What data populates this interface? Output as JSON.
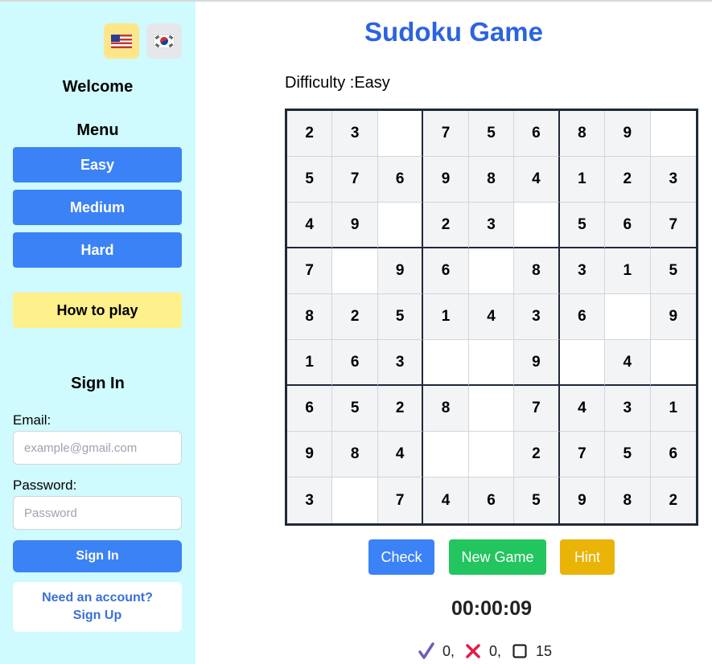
{
  "sidebar": {
    "languages": [
      {
        "code": "en",
        "icon": "us-flag-icon"
      },
      {
        "code": "ko",
        "icon": "kr-flag-icon"
      }
    ],
    "welcome": "Welcome",
    "menu_title": "Menu",
    "menu_items": [
      "Easy",
      "Medium",
      "Hard"
    ],
    "how_to_play": "How to play",
    "sign_in": {
      "title": "Sign In",
      "email_label": "Email:",
      "email_placeholder": "example@gmail.com",
      "email_value": "",
      "password_label": "Password:",
      "password_placeholder": "Password",
      "password_value": "",
      "submit_label": "Sign In",
      "signup_link": "Need an account? Sign Up"
    }
  },
  "main": {
    "title": "Sudoku Game",
    "difficulty": "Difficulty :Easy",
    "board": [
      [
        2,
        3,
        0,
        7,
        5,
        6,
        8,
        9,
        0
      ],
      [
        5,
        7,
        6,
        9,
        8,
        4,
        1,
        2,
        3
      ],
      [
        4,
        9,
        0,
        2,
        3,
        0,
        5,
        6,
        7
      ],
      [
        7,
        0,
        9,
        6,
        0,
        8,
        3,
        1,
        5
      ],
      [
        8,
        2,
        5,
        1,
        4,
        3,
        6,
        0,
        9
      ],
      [
        1,
        6,
        3,
        0,
        0,
        9,
        0,
        4,
        0
      ],
      [
        6,
        5,
        2,
        8,
        0,
        7,
        4,
        3,
        1
      ],
      [
        9,
        8,
        4,
        0,
        0,
        2,
        7,
        5,
        6
      ],
      [
        3,
        0,
        7,
        4,
        6,
        5,
        9,
        8,
        2
      ]
    ],
    "buttons": {
      "check": "Check",
      "new_game": "New Game",
      "hint": "Hint"
    },
    "timer": "00:00:09",
    "stats": {
      "correct": "0,",
      "wrong": "0,",
      "empty": "15"
    }
  },
  "colors": {
    "sidebar_bg": "#cffafe",
    "primary": "#3b82f6",
    "success": "#22c55e",
    "warning": "#eab308",
    "title": "#2b63e0"
  }
}
